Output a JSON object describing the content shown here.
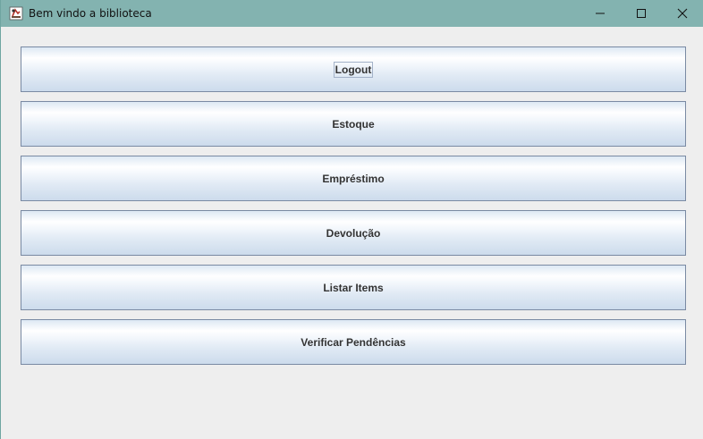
{
  "window": {
    "title": "Bem vindo a biblioteca"
  },
  "title_controls": {
    "minimize_icon": "minimize-icon",
    "maximize_icon": "maximize-icon",
    "close_icon": "close-icon"
  },
  "menu": {
    "buttons": [
      {
        "label": "Logout",
        "focused": true
      },
      {
        "label": "Estoque"
      },
      {
        "label": "Empréstimo"
      },
      {
        "label": "Devolução"
      },
      {
        "label": "Listar Items"
      },
      {
        "label": "Verificar Pendências"
      }
    ]
  },
  "colors": {
    "titlebar": "#83b3b0",
    "window_bg": "#eeeeee",
    "button_border": "#7a8aa3",
    "button_text": "#333333"
  }
}
